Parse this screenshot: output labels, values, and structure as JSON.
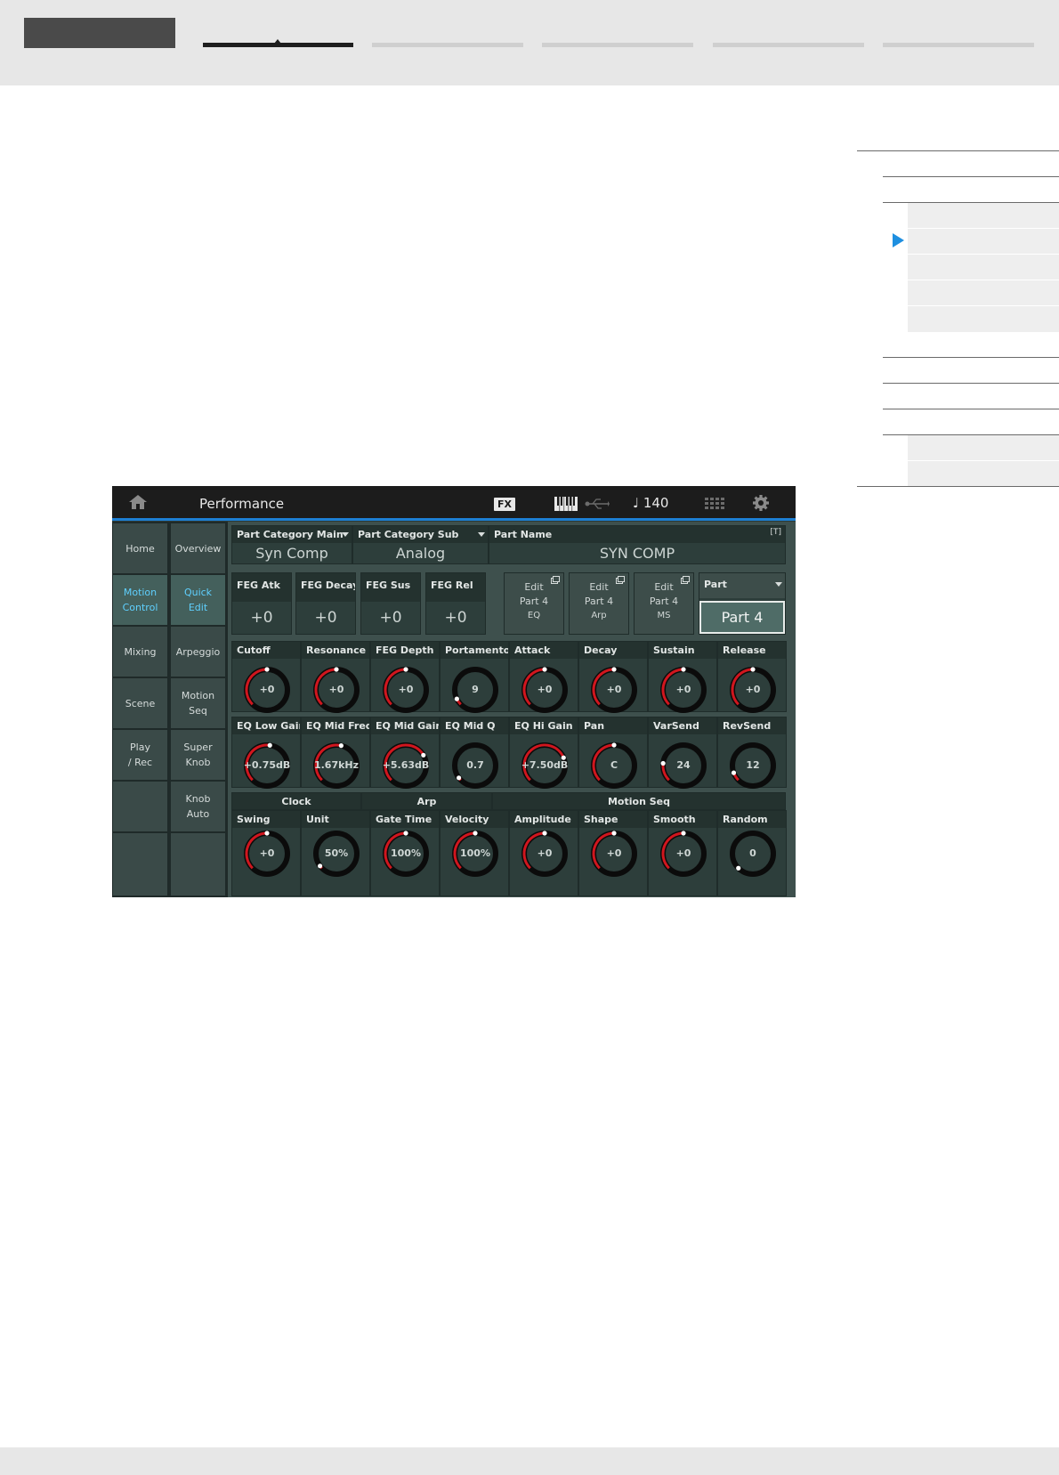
{
  "screen": {
    "header": {
      "title": "Performance",
      "fx_label": "FX",
      "tempo": "♩ 140"
    },
    "left_nav": {
      "col1": [
        "Home",
        "Motion\nControl",
        "Mixing",
        "Scene",
        "Play\n/ Rec",
        ""
      ],
      "col2": [
        "Overview",
        "Quick\nEdit",
        "Arpeggio",
        "Motion\nSeq",
        "Super\nKnob",
        "Knob\nAuto",
        ""
      ],
      "selected_col1": "Motion\nControl",
      "selected_col2": "Quick\nEdit"
    },
    "part_info": {
      "category_main_label": "Part Category Main",
      "category_main_value": "Syn Comp",
      "category_sub_label": "Part Category Sub",
      "category_sub_value": "Analog",
      "part_name_label": "Part Name",
      "part_name_value": "SYN COMP",
      "text_icon": "[T]"
    },
    "feg": [
      {
        "label": "FEG Atk",
        "value": "+0"
      },
      {
        "label": "FEG Decay",
        "value": "+0"
      },
      {
        "label": "FEG Sus",
        "value": "+0"
      },
      {
        "label": "FEG Rel",
        "value": "+0"
      }
    ],
    "edit_buttons": [
      {
        "label": "Edit\nPart 4",
        "sub": "EQ"
      },
      {
        "label": "Edit\nPart 4",
        "sub": "Arp"
      },
      {
        "label": "Edit\nPart 4",
        "sub": "MS"
      }
    ],
    "part_select": {
      "label": "Part",
      "value": "Part 4"
    },
    "knob_row1": [
      {
        "label": "Cutoff",
        "value": "+0",
        "level": 0.5
      },
      {
        "label": "Resonance",
        "value": "+0",
        "level": 0.5
      },
      {
        "label": "FEG Depth",
        "value": "+0",
        "level": 0.5
      },
      {
        "label": "Portamento",
        "value": "9",
        "level": 0.07
      },
      {
        "label": "Attack",
        "value": "+0",
        "level": 0.5
      },
      {
        "label": "Decay",
        "value": "+0",
        "level": 0.5
      },
      {
        "label": "Sustain",
        "value": "+0",
        "level": 0.5
      },
      {
        "label": "Release",
        "value": "+0",
        "level": 0.5
      }
    ],
    "knob_row2": [
      {
        "label": "EQ Low Gain",
        "value": "+0.75dB",
        "level": 0.53
      },
      {
        "label": "EQ Mid Freq",
        "value": "1.67kHz",
        "level": 0.55
      },
      {
        "label": "EQ Mid Gain",
        "value": "+5.63dB",
        "level": 0.72
      },
      {
        "label": "EQ Mid Q",
        "value": "0.7",
        "level": 0.03
      },
      {
        "label": "EQ Hi Gain",
        "value": "+7.50dB",
        "level": 0.75
      },
      {
        "label": "Pan",
        "value": "C",
        "level": 0.5
      },
      {
        "label": "VarSend",
        "value": "24",
        "level": 0.19
      },
      {
        "label": "RevSend",
        "value": "12",
        "level": 0.09
      }
    ],
    "groups": [
      {
        "label": "Clock"
      },
      {
        "label": "Arp"
      },
      {
        "label": "Motion Seq"
      }
    ],
    "knob_row3": [
      {
        "label": "Swing",
        "value": "+0",
        "level": 0.5
      },
      {
        "label": "Unit",
        "value": "50%",
        "level": 0.03
      },
      {
        "label": "Gate Time",
        "value": "100%",
        "level": 0.5
      },
      {
        "label": "Velocity",
        "value": "100%",
        "level": 0.5
      },
      {
        "label": "Amplitude",
        "value": "+0",
        "level": 0.5
      },
      {
        "label": "Shape",
        "value": "+0",
        "level": 0.5
      },
      {
        "label": "Smooth",
        "value": "+0",
        "level": 0.5
      },
      {
        "label": "Random",
        "value": "0",
        "level": 0.0
      }
    ]
  },
  "colors": {
    "accent_blue": "#1d7fd3",
    "knob_arc_red": "#d0161e",
    "selected_text": "#5fd0ff",
    "toc_arrow": "#1e8fe0"
  },
  "icons": [
    "home-icon",
    "keyboard-icon",
    "usb-icon",
    "grid-icon",
    "gear-icon",
    "external-window-icon",
    "dropdown-caret-icon",
    "text-input-icon",
    "toc-arrow-icon"
  ]
}
